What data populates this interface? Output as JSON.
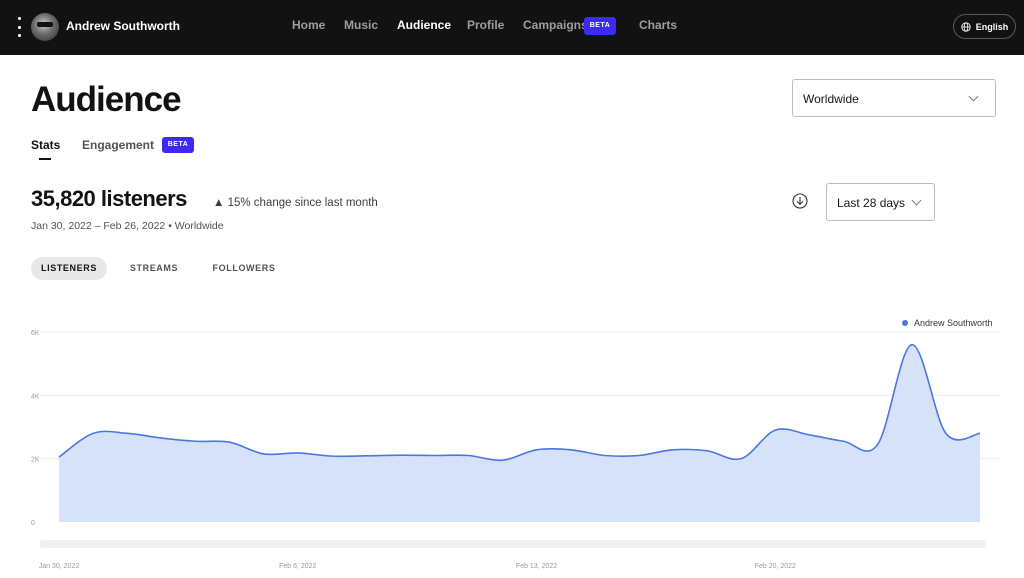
{
  "nav": {
    "artist_name": "Andrew Southworth",
    "items": [
      {
        "label": "Home",
        "active": false
      },
      {
        "label": "Music",
        "active": false
      },
      {
        "label": "Audience",
        "active": true
      },
      {
        "label": "Profile",
        "active": false
      },
      {
        "label": "Campaigns",
        "active": false
      },
      {
        "label": "Charts",
        "active": false
      }
    ],
    "campaigns_badge": "BETA",
    "language": "English",
    "colors": {
      "background": "#121212",
      "badge": "#3d2bf5"
    }
  },
  "header": {
    "title": "Audience",
    "region": {
      "selected": "Worldwide"
    }
  },
  "subtabs": {
    "items": [
      {
        "label": "Stats",
        "active": true
      },
      {
        "label": "Engagement",
        "active": false
      }
    ],
    "engagement_badge": "BETA"
  },
  "stats": {
    "headline": "35,820 listeners",
    "change": "▲ 15% change since last month",
    "date_range": "Jan 30, 2022 – Feb 26, 2022 • Worldwide",
    "period": {
      "selected": "Last 28 days"
    }
  },
  "metric_tabs": [
    {
      "label": "LISTENERS",
      "active": true
    },
    {
      "label": "STREAMS",
      "active": false
    },
    {
      "label": "FOLLOWERS",
      "active": false
    }
  ],
  "chart_data": {
    "type": "area",
    "ylim": [
      0,
      6000
    ],
    "yticks": [
      "0",
      "2K",
      "4K",
      "6K"
    ],
    "xticks": [
      "Jan 30, 2022",
      "Feb 6, 2022",
      "Feb 13, 2022",
      "Feb 20, 2022"
    ],
    "legend": "top-right",
    "grid": true,
    "colors": {
      "line": "#4a77e5",
      "fill": "#d6e2fa"
    },
    "series": [
      {
        "name": "Andrew Southworth",
        "x": [
          "Jan 30",
          "Jan 31",
          "Feb 1",
          "Feb 2",
          "Feb 3",
          "Feb 4",
          "Feb 5",
          "Feb 6",
          "Feb 7",
          "Feb 8",
          "Feb 9",
          "Feb 10",
          "Feb 11",
          "Feb 12",
          "Feb 13",
          "Feb 14",
          "Feb 15",
          "Feb 16",
          "Feb 17",
          "Feb 18",
          "Feb 19",
          "Feb 20",
          "Feb 21",
          "Feb 22",
          "Feb 23",
          "Feb 24",
          "Feb 25",
          "Feb 26"
        ],
        "values": [
          2050,
          2800,
          2800,
          2650,
          2550,
          2520,
          2150,
          2180,
          2080,
          2090,
          2110,
          2100,
          2100,
          1950,
          2280,
          2280,
          2100,
          2100,
          2280,
          2250,
          2000,
          2900,
          2750,
          2550,
          2450,
          5600,
          2800,
          2800
        ]
      }
    ]
  }
}
